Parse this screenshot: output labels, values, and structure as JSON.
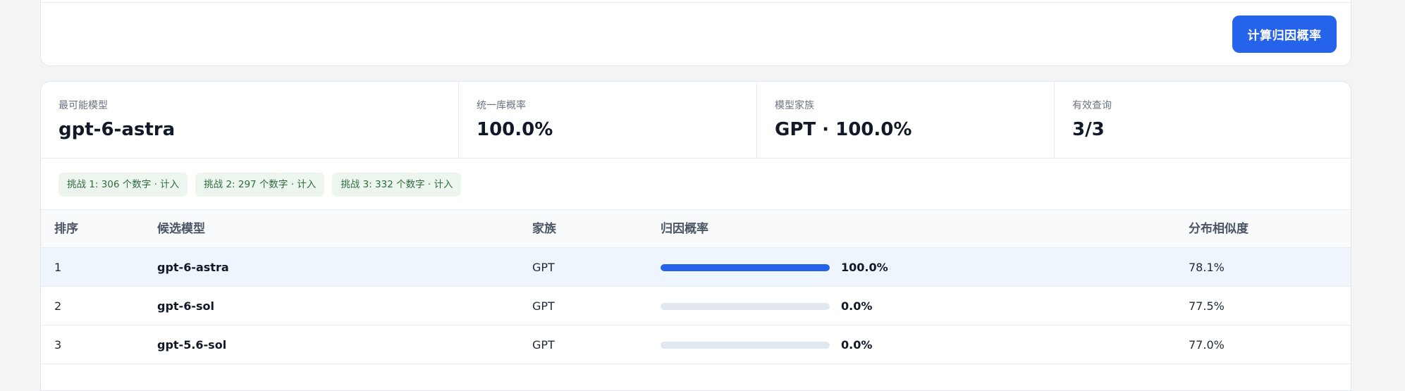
{
  "toolbar": {
    "compute_label": "计算归因概率"
  },
  "stats": [
    {
      "label": "最可能模型",
      "value": "gpt-6-astra"
    },
    {
      "label": "统一库概率",
      "value": "100.0%"
    },
    {
      "label": "模型家族",
      "value": "GPT · 100.0%"
    },
    {
      "label": "有效查询",
      "value": "3/3"
    }
  ],
  "challenges": [
    "挑战 1: 306 个数字 · 计入",
    "挑战 2: 297 个数字 · 计入",
    "挑战 3: 332 个数字 · 计入"
  ],
  "table": {
    "headers": {
      "rank": "排序",
      "model": "候选模型",
      "family": "家族",
      "probability": "归因概率",
      "similarity": "分布相似度"
    },
    "rows": [
      {
        "rank": "1",
        "model": "gpt-6-astra",
        "family": "GPT",
        "probability": 1.0,
        "probability_label": "100.0%",
        "similarity": "78.1%"
      },
      {
        "rank": "2",
        "model": "gpt-6-sol",
        "family": "GPT",
        "probability": 0.0,
        "probability_label": "0.0%",
        "similarity": "77.5%"
      },
      {
        "rank": "3",
        "model": "gpt-5.6-sol",
        "family": "GPT",
        "probability": 0.0,
        "probability_label": "0.0%",
        "similarity": "77.0%"
      }
    ]
  },
  "colors": {
    "accent": "#2563eb",
    "bar_track": "#e2e8f0",
    "chip_bg": "#ecf6ee",
    "chip_text": "#2f6b3e",
    "active_row": "#eef5fd"
  }
}
